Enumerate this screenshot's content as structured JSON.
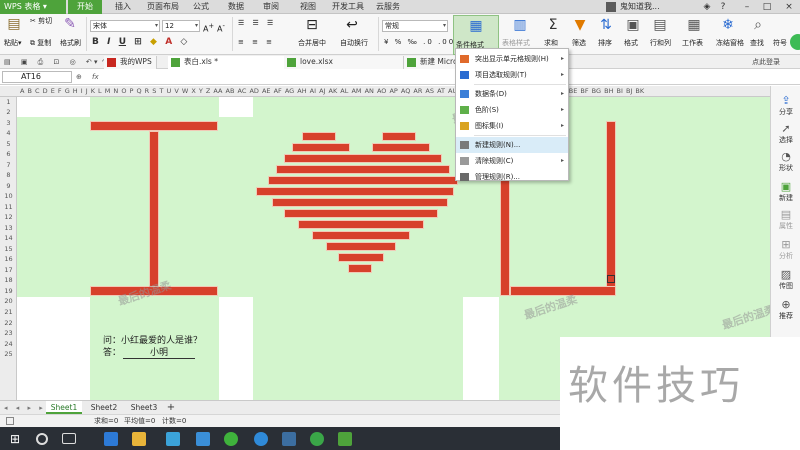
{
  "app": {
    "name": "WPS 表格"
  },
  "ribbon_tabs": [
    "开始",
    "插入",
    "页面布局",
    "公式",
    "数据",
    "审阅",
    "视图",
    "开发工具",
    "云服务"
  ],
  "active_tab": "开始",
  "user": {
    "name": "鬼知道我..."
  },
  "ribbon": {
    "paste": "粘贴",
    "cut": "剪切",
    "copy": "复制",
    "format_painter": "格式刷",
    "font_name": "宋体",
    "font_size": "12",
    "merge_center": "合并居中",
    "auto_wrap": "自动换行",
    "number_format": "常规",
    "conditional_format": "条件格式",
    "table_style": "表格样式",
    "sum": "求和",
    "filter": "筛选",
    "sort": "排序",
    "format": "格式",
    "row_col": "行和列",
    "worksheet": "工作表",
    "freeze": "冻结窗格",
    "find": "查找",
    "symbol": "符号"
  },
  "doc_tabs": [
    "我的WPS",
    "表白.xls *",
    "love.xlsx",
    "新建 Micro"
  ],
  "unread_label": "点此登录",
  "name_box": "AT16",
  "fx": "fx",
  "columns": "A B C D E F G H I J K L M N O P Q R S T U V W X Y Z AA AB AC AD AE AF AG AH AI AJ AK AL AM AN AO AP AQ AR AS AT AU AV AW AX AY AZ BA BB BC BD BE BF BG BH BI BJ BK",
  "rows": [
    "1",
    "2",
    "3",
    "4",
    "5",
    "6",
    "7",
    "8",
    "9",
    "10",
    "11",
    "12",
    "13",
    "14",
    "15",
    "16",
    "17",
    "18",
    "19",
    "20",
    "21",
    "22",
    "23",
    "24",
    "25"
  ],
  "menu": {
    "items": [
      {
        "label": "突出显示单元格规则(H)",
        "submenu": true
      },
      {
        "label": "项目选取规则(T)",
        "submenu": true
      },
      {
        "label": "数据条(D)",
        "submenu": true
      },
      {
        "label": "色阶(S)",
        "submenu": true
      },
      {
        "label": "图标集(I)",
        "submenu": true
      },
      {
        "label": "新建规则(N)...",
        "submenu": false
      },
      {
        "label": "清除规则(C)",
        "submenu": true
      },
      {
        "label": "管理规则(R)...",
        "submenu": false
      }
    ],
    "highlighted": "新建规则(N)..."
  },
  "question": "问：小红最爱的人是谁？",
  "answer_label": "答：",
  "answer_value": "小明",
  "watermark_small": "最后的温柔",
  "right_panel": [
    "分享",
    "选择",
    "形状",
    "新建",
    "属性",
    "分析",
    "传图",
    "推荐"
  ],
  "sheets": [
    "Sheet1",
    "Sheet2",
    "Sheet3"
  ],
  "active_sheet": "Sheet1",
  "add_sheet": "+",
  "status": {
    "sum": "求和=0",
    "avg": "平均值=0",
    "count": "计数=0"
  },
  "watermark": "软件技巧",
  "colors": {
    "accent": "#4ea33b",
    "heart": "#d7402b",
    "cell_fill": "#d3f5cd",
    "highlight": "#d9ecf8"
  }
}
